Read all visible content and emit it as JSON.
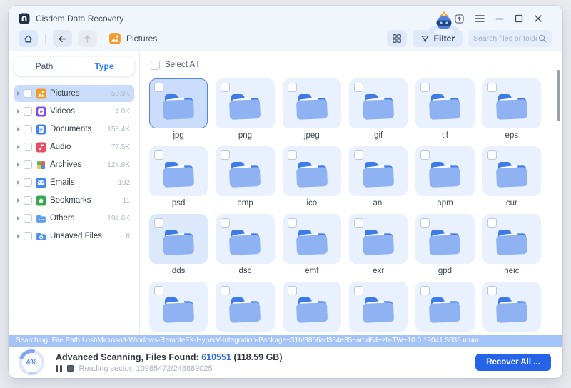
{
  "titlebar": {
    "title": "Cisdem Data Recovery",
    "control_icons": [
      "upgrade-icon",
      "menu-icon",
      "minimize-icon",
      "maximize-icon",
      "close-icon"
    ]
  },
  "navbar": {
    "location_label": "Pictures",
    "filter_label": "Filter",
    "search_placeholder": "Search files or folders"
  },
  "sidebar": {
    "tabs": [
      {
        "label": "Path",
        "active": false
      },
      {
        "label": "Type",
        "active": true
      }
    ],
    "items": [
      {
        "label": "Pictures",
        "count": "50.9K",
        "icon": "pictures-icon",
        "selected": true
      },
      {
        "label": "Videos",
        "count": "4.0K",
        "icon": "videos-icon",
        "selected": false
      },
      {
        "label": "Documents",
        "count": "158.4K",
        "icon": "documents-icon",
        "selected": false
      },
      {
        "label": "Audio",
        "count": "77.5K",
        "icon": "audio-icon",
        "selected": false
      },
      {
        "label": "Archives",
        "count": "124.9K",
        "icon": "archives-icon",
        "selected": false
      },
      {
        "label": "Emails",
        "count": "192",
        "icon": "emails-icon",
        "selected": false
      },
      {
        "label": "Bookmarks",
        "count": "11",
        "icon": "bookmarks-icon",
        "selected": false
      },
      {
        "label": "Others",
        "count": "194.6K",
        "icon": "others-icon",
        "selected": false
      },
      {
        "label": "Unsaved Files",
        "count": "8",
        "icon": "unsaved-icon",
        "selected": false
      }
    ]
  },
  "content": {
    "select_all_label": "Select All",
    "folders": [
      {
        "name": "jpg",
        "state": "selected"
      },
      {
        "name": "png",
        "state": "normal"
      },
      {
        "name": "jpeg",
        "state": "normal"
      },
      {
        "name": "gif",
        "state": "normal"
      },
      {
        "name": "tif",
        "state": "normal"
      },
      {
        "name": "eps",
        "state": "normal"
      },
      {
        "name": "psd",
        "state": "normal"
      },
      {
        "name": "bmp",
        "state": "normal"
      },
      {
        "name": "ico",
        "state": "normal"
      },
      {
        "name": "ani",
        "state": "normal"
      },
      {
        "name": "apm",
        "state": "normal"
      },
      {
        "name": "cur",
        "state": "normal"
      },
      {
        "name": "dds",
        "state": "hover"
      },
      {
        "name": "dsc",
        "state": "normal"
      },
      {
        "name": "emf",
        "state": "normal"
      },
      {
        "name": "exr",
        "state": "normal"
      },
      {
        "name": "gpd",
        "state": "normal"
      },
      {
        "name": "heic",
        "state": "normal"
      },
      {
        "name": "",
        "state": "partial"
      },
      {
        "name": "",
        "state": "partial"
      },
      {
        "name": "",
        "state": "partial"
      },
      {
        "name": "",
        "state": "partial"
      },
      {
        "name": "",
        "state": "partial"
      },
      {
        "name": "",
        "state": "partial"
      }
    ]
  },
  "status_strip": {
    "text": "Searching: File Path Lost\\Microsoft-Windows-RemoteFX-HyperV-Integration-Package~31bf3856ad364e35~amd64~zh-TW~10.0.19041.3636.mum"
  },
  "footer": {
    "progress": "4%",
    "scan_label": "Advanced Scanning, Files Found:",
    "files_found": "610551",
    "size_label": "(118.59 GB)",
    "reading_label": "Reading sector: 10985472/248889025",
    "recover_label": "Recover All ..."
  },
  "colors": {
    "accent": "#2563E8",
    "topbar_bg": "#F1F6FD",
    "tile_bg": "#EAF1FE",
    "tile_selected_bg": "#CBDDFA",
    "tile_selected_border": "#4F86EC",
    "sidebar_selected_bg": "#C9DCF9",
    "status_strip_bg": "#A4C3F6",
    "folder_front": "#8FB3F2",
    "folder_back": "#3D7BE8"
  }
}
